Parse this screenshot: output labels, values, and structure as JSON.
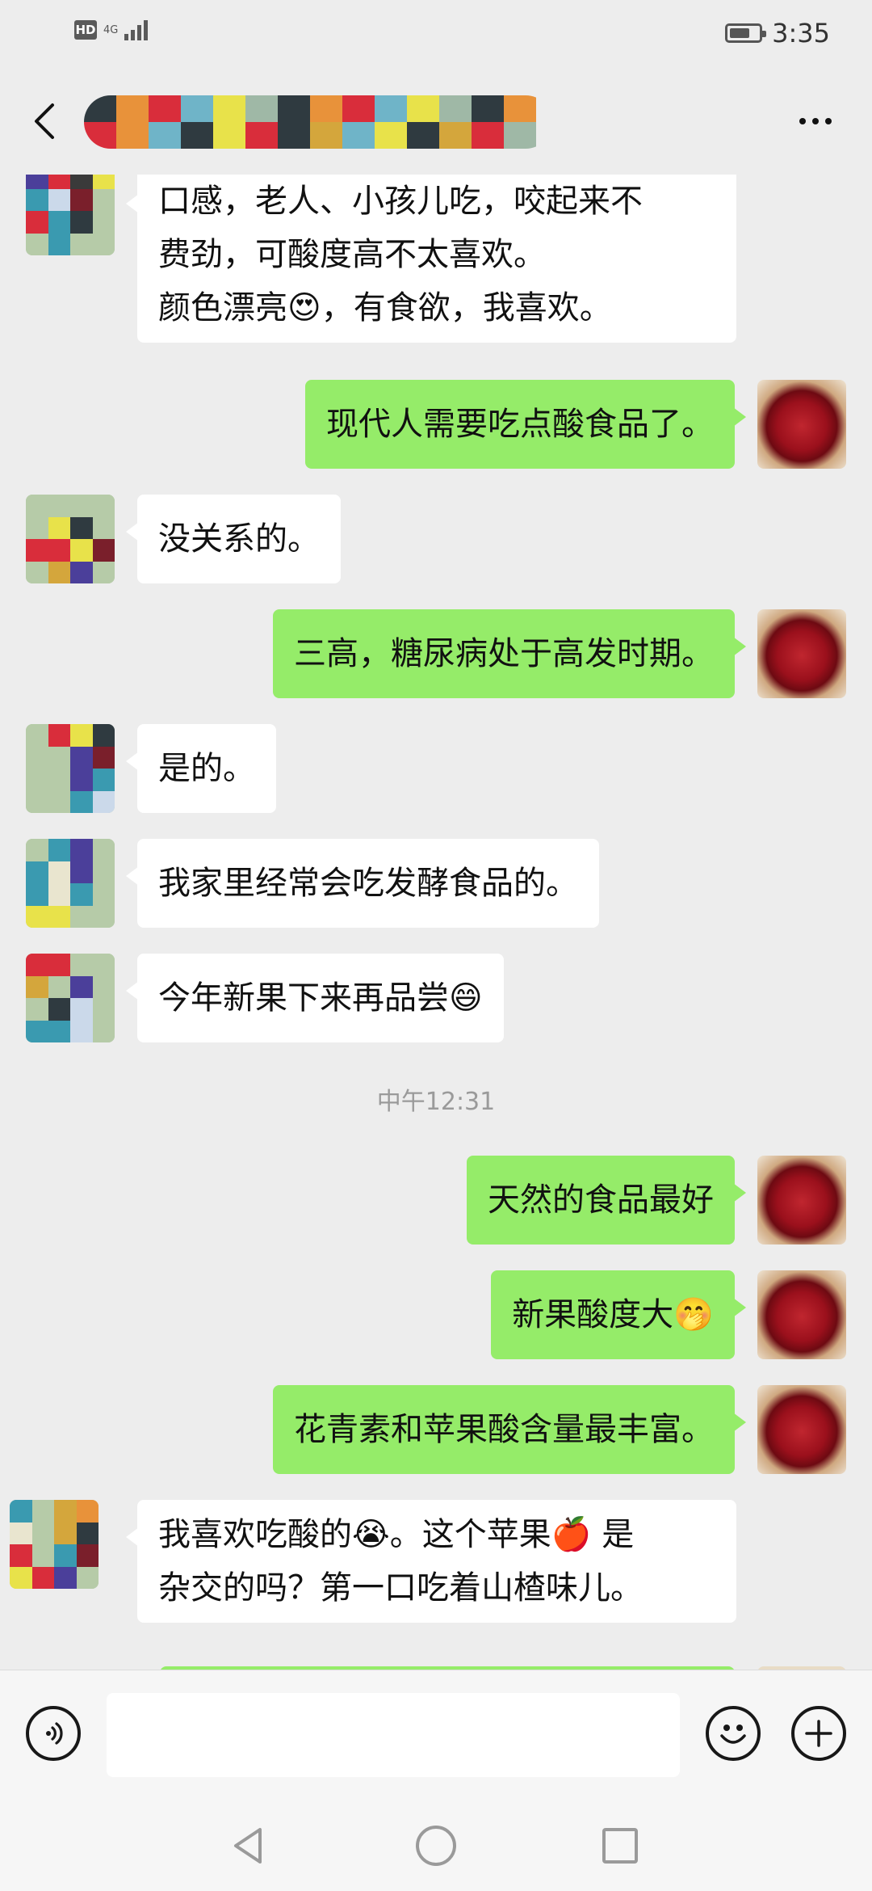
{
  "status_bar": {
    "hd_label": "HD",
    "network_label": "4G",
    "time": "3:35"
  },
  "header": {
    "title": ""
  },
  "messages": [
    {
      "side": "in",
      "lines": [
        "口感，老人、小孩儿吃，咬起来不",
        "费劲，可酸度高不太喜欢。",
        "颜色漂亮😍，有食欲，我喜欢。"
      ]
    },
    {
      "side": "out",
      "text": "现代人需要吃点酸食品了。"
    },
    {
      "side": "in",
      "text": "没关系的。"
    },
    {
      "side": "out",
      "text": "三高，糖尿病处于高发时期。"
    },
    {
      "side": "in",
      "text": "是的。"
    },
    {
      "side": "in",
      "text": "我家里经常会吃发酵食品的。"
    },
    {
      "side": "in",
      "text": "今年新果下来再品尝😄"
    },
    {
      "side": "out",
      "text": "天然的食品最好"
    },
    {
      "side": "out",
      "text": "新果酸度大🤭"
    },
    {
      "side": "out",
      "text": "花青素和苹果酸含量最丰富。"
    },
    {
      "side": "in",
      "lines": [
        "我喜欢吃酸的😭。这个苹果🍎 是",
        "杂交的吗？第一口吃着山楂味儿。"
      ]
    }
  ],
  "timestamp": "中午12:31",
  "input": {
    "value": "",
    "voice_icon": "voice-icon",
    "emoji_icon": "emoji-icon",
    "plus_icon": "plus-icon"
  },
  "nav": {
    "back_icon": "nav-back-icon",
    "home_icon": "nav-home-icon",
    "recents_icon": "nav-recents-icon"
  },
  "colors": {
    "background": "#EDEDED",
    "outgoing_bubble": "#95EC69",
    "incoming_bubble": "#FFFFFF"
  }
}
